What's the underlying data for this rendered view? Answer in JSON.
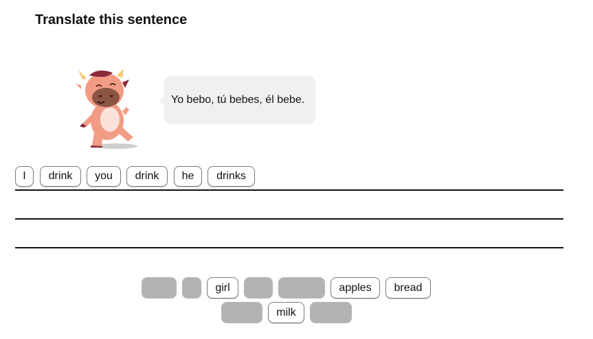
{
  "header": {
    "title": "Translate this sentence"
  },
  "prompt": {
    "sentence": "Yo bebo, tú bebes, él bebe.",
    "mascot_icon": "cartoon-cow-mascot-icon"
  },
  "answer": {
    "selected_words": [
      "I",
      "drink",
      "you",
      "drink",
      "he",
      "drinks"
    ]
  },
  "word_bank": {
    "available_words": [
      "girl",
      "apples",
      "bread",
      "milk"
    ],
    "used_slot_count": 6
  },
  "colors": {
    "slot_gray": "#b3b3b3",
    "chip_border": "#7a7a7a",
    "bubble_bg": "#f0f0f0",
    "mascot_body": "#f29c86",
    "mascot_muzzle": "#8b5544"
  }
}
